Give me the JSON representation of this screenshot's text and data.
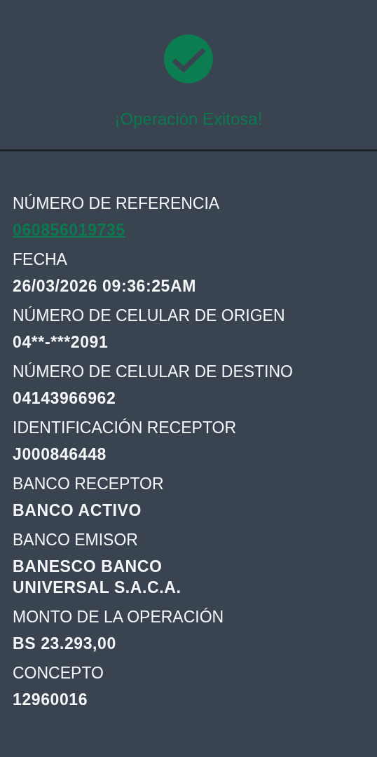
{
  "status": {
    "title": "¡Operación Exitosa!"
  },
  "fields": [
    {
      "label": "NÚMERO DE REFERENCIA",
      "value": "060856019735",
      "kind": "link"
    },
    {
      "label": "FECHA",
      "value": "26/03/2026 09:36:25AM",
      "kind": "text"
    },
    {
      "label": "NÚMERO DE CELULAR DE ORIGEN",
      "value": "04**-***2091",
      "kind": "text"
    },
    {
      "label": "NÚMERO DE CELULAR DE DESTINO",
      "value": "04143966962",
      "kind": "text"
    },
    {
      "label": "IDENTIFICACIÓN RECEPTOR",
      "value": "J000846448",
      "kind": "text"
    },
    {
      "label": "BANCO RECEPTOR",
      "value": "BANCO ACTIVO",
      "kind": "text"
    },
    {
      "label": "BANCO EMISOR",
      "value": "BANESCO BANCO UNIVERSAL S.A.C.A.",
      "kind": "text"
    },
    {
      "label": "MONTO DE LA OPERACIÓN",
      "value": "BS 23.293,00",
      "kind": "text"
    },
    {
      "label": "CONCEPTO",
      "value": "12960016",
      "kind": "text"
    }
  ]
}
